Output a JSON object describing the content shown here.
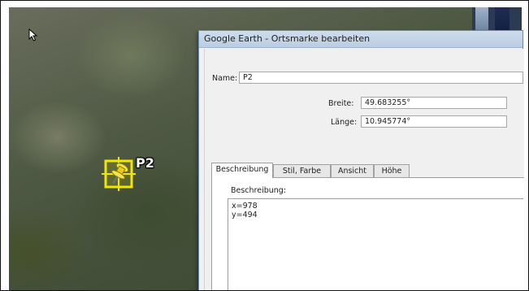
{
  "placemark": {
    "label": "P2",
    "icon": "yellow-pushpin-icon"
  },
  "dialog": {
    "title": "Google Earth - Ortsmarke bearbeiten",
    "name_label": "Name:",
    "name_value": "P2",
    "latitude_label": "Breite:",
    "latitude_value": "49.683255°",
    "longitude_label": "Länge:",
    "longitude_value": "10.945774°",
    "tabs": [
      {
        "label": "Beschreibung",
        "active": true
      },
      {
        "label": "Stil, Farbe",
        "active": false
      },
      {
        "label": "Ansicht",
        "active": false
      },
      {
        "label": "Höhe",
        "active": false
      }
    ],
    "description_label": "Beschreibung:",
    "description_lines": [
      "x=978",
      "y=494"
    ]
  },
  "colors": {
    "placemark_highlight": "#f2e600",
    "titlebar": "#c8d7ea"
  }
}
